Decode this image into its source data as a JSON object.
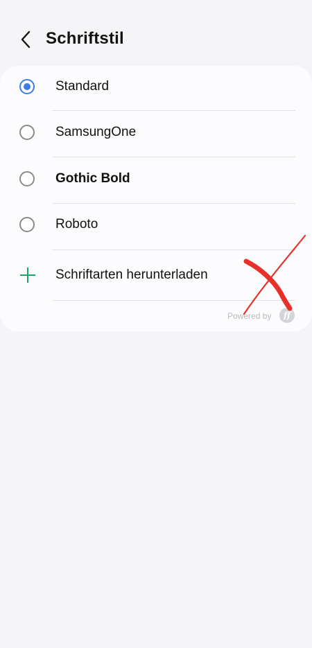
{
  "header": {
    "title": "Schriftstil",
    "back_icon": "chevron-left-icon"
  },
  "options": [
    {
      "label": "Standard",
      "selected": true,
      "bold": false
    },
    {
      "label": "SamsungOne",
      "selected": false,
      "bold": false
    },
    {
      "label": "Gothic Bold",
      "selected": false,
      "bold": true
    },
    {
      "label": "Roboto",
      "selected": false,
      "bold": false
    }
  ],
  "download": {
    "label": "Schriftarten herunterladen",
    "icon": "plus-icon"
  },
  "footer": {
    "powered_by": "Powered by",
    "logo_text": "ff"
  },
  "colors": {
    "accent": "#3e7be6",
    "plus": "#16a56a",
    "background": "#f5f5f7",
    "card": "#fcfcfe",
    "annotation": "#e8302a"
  }
}
